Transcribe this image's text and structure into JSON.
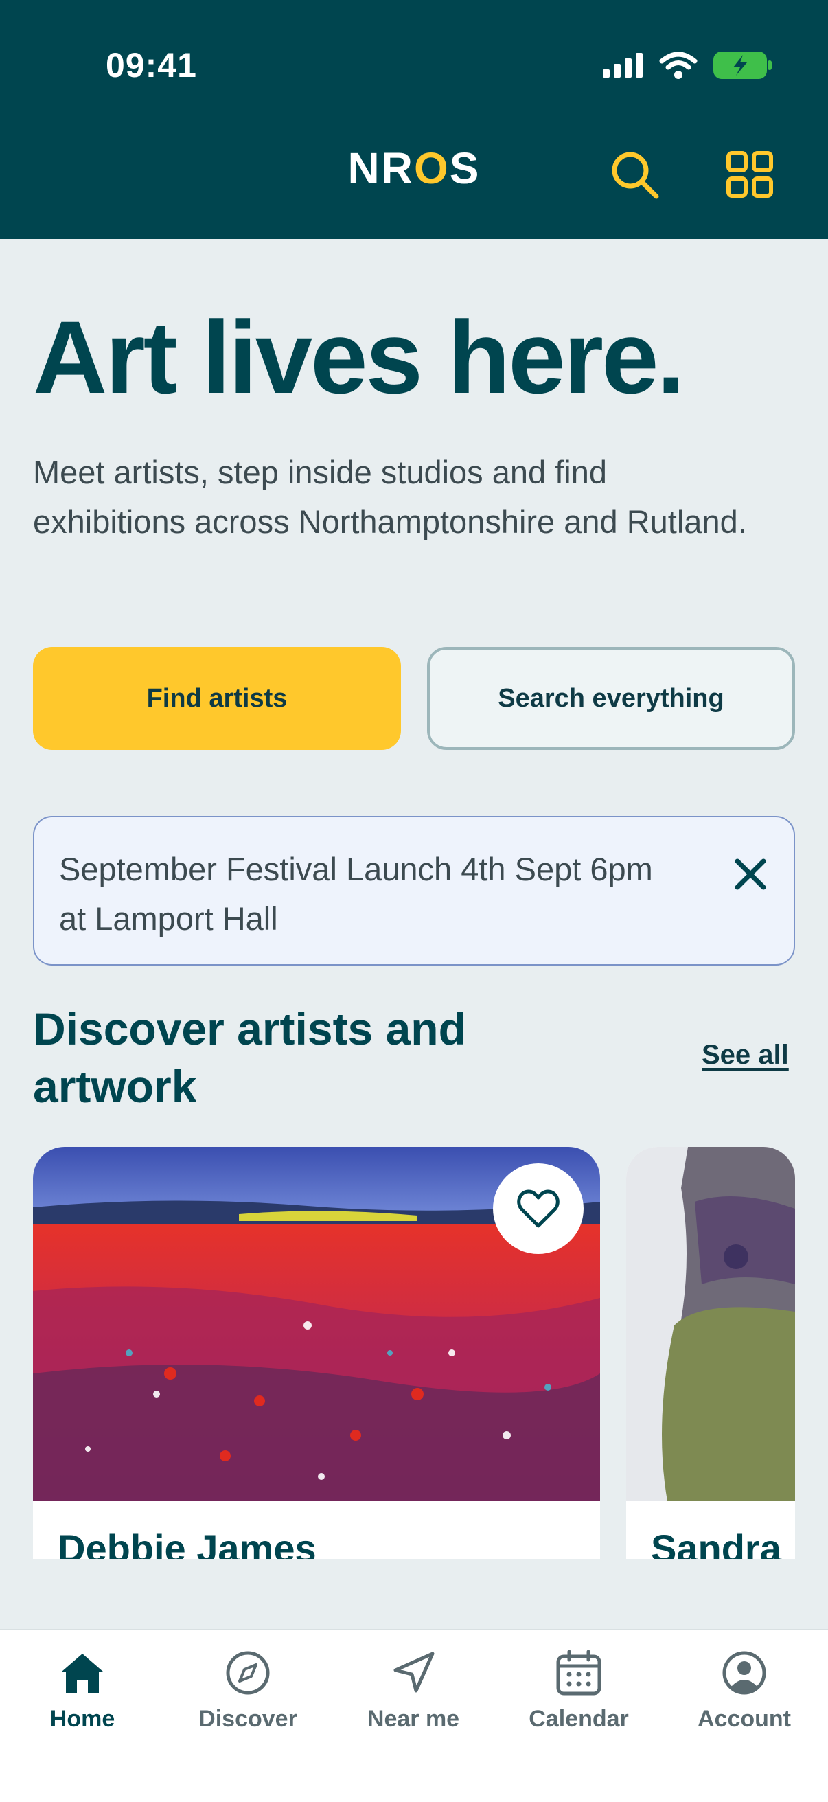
{
  "status_bar": {
    "time": "09:41"
  },
  "header": {
    "logo_prefix": "NR",
    "logo_o": "O",
    "logo_suffix": "S"
  },
  "hero": {
    "title": "Art lives here.",
    "subtitle": "Meet artists, step inside studios and find exhibitions across Northamptonshire and Rutland."
  },
  "buttons": {
    "find_artists": "Find artists",
    "search_everything": "Search everything"
  },
  "banner": {
    "text": "September Festival Launch 4th Sept 6pm at Lamport Hall"
  },
  "discover": {
    "title": "Discover artists and artwork",
    "see_all": "See all",
    "cards": [
      {
        "artist": "Debbie James"
      },
      {
        "artist": "Sandra"
      }
    ]
  },
  "nav": {
    "items": [
      {
        "label": "Home",
        "icon": "home-icon",
        "active": true
      },
      {
        "label": "Discover",
        "icon": "compass-icon"
      },
      {
        "label": "Near me",
        "icon": "navigation-arrow-icon"
      },
      {
        "label": "Calendar",
        "icon": "calendar-icon"
      },
      {
        "label": "Account",
        "icon": "account-icon"
      }
    ]
  },
  "colors": {
    "brand_dark": "#00454f",
    "accent_yellow": "#ffc82c",
    "background": "#e8eef0"
  }
}
